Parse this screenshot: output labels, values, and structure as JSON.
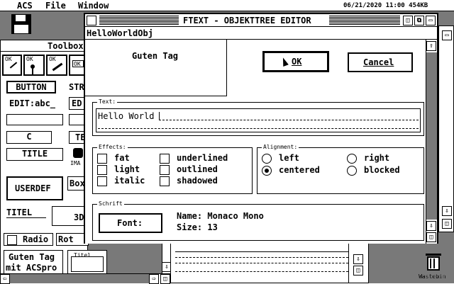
{
  "menubar": {
    "app": "ACS",
    "file": "File",
    "window": "Window",
    "clock": "06/21/2020 11:00 454KB"
  },
  "desktop": {
    "trash_label": "Wastebin"
  },
  "toolbox": {
    "title": "Toolbox",
    "button": "BUTTON",
    "str": "STR",
    "edit": "EDIT:abc_",
    "ed": "ED",
    "c": "C",
    "te": "TE",
    "title_item": "TITLE",
    "ima": "IMA",
    "userdef": "USERDEF",
    "box": "Box",
    "titel": "TITEL",
    "threed": "3D",
    "radio": "Radio",
    "rot": "Rot",
    "guten1": "Guten Tag",
    "guten2": "mit ACSpro",
    "titel_frame": "Titel",
    "ok_icon": "OK"
  },
  "dialog": {
    "title": "FTEXT - OBJEKTTREE EDITOR",
    "object_name": "HelloWorldObj",
    "preview_text": "Guten Tag",
    "ok": "OK",
    "cancel": "Cancel",
    "text_group": "Text:",
    "text_value": "Hello World",
    "effects_group": "Effects:",
    "effects": [
      {
        "label": "fat",
        "checked": false
      },
      {
        "label": "light",
        "checked": false
      },
      {
        "label": "italic",
        "checked": false
      },
      {
        "label": "underlined",
        "checked": false
      },
      {
        "label": "outlined",
        "checked": false
      },
      {
        "label": "shadowed",
        "checked": false
      }
    ],
    "alignment_group": "Alignment:",
    "alignment": [
      {
        "label": "left",
        "selected": false
      },
      {
        "label": "centered",
        "selected": true
      },
      {
        "label": "right",
        "selected": false
      },
      {
        "label": "blocked",
        "selected": false
      }
    ],
    "font_group": "Schrift",
    "font_button": "Font:",
    "font_name": "Name: Monaco Mono",
    "font_size": "Size: 13"
  }
}
